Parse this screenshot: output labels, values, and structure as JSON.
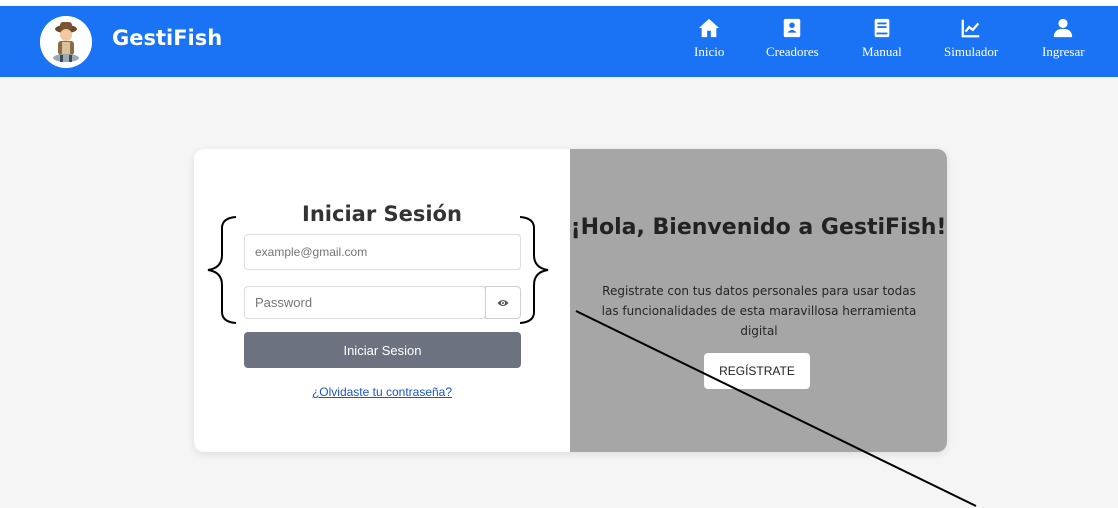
{
  "app": {
    "name": "GestiFish"
  },
  "nav": {
    "items": [
      {
        "label": "Inicio",
        "icon": "home-icon"
      },
      {
        "label": "Creadores",
        "icon": "contact-book-icon"
      },
      {
        "label": "Manual",
        "icon": "book-icon"
      },
      {
        "label": "Simulador",
        "icon": "chart-icon"
      },
      {
        "label": "Ingresar",
        "icon": "user-icon"
      }
    ]
  },
  "login": {
    "title": "Iniciar Sesión",
    "email_placeholder": "example@gmail.com",
    "password_placeholder": "Password",
    "show_password_icon": "eye-icon",
    "submit_label": "Iniciar Sesion",
    "forgot_link": "¿Olvidaste tu contraseña?"
  },
  "welcome": {
    "title": "¡Hola, Bienvenido a GestiFish!",
    "text": "Registrate con tus datos personales para usar todas las funcionalidades de esta maravillosa herramienta digital",
    "register_label": "REGÍSTRATE"
  },
  "colors": {
    "topbar": "#1a73f5",
    "card_right": "#a6a6a6",
    "submit_button": "#6c7280",
    "link": "#1a56c8"
  }
}
